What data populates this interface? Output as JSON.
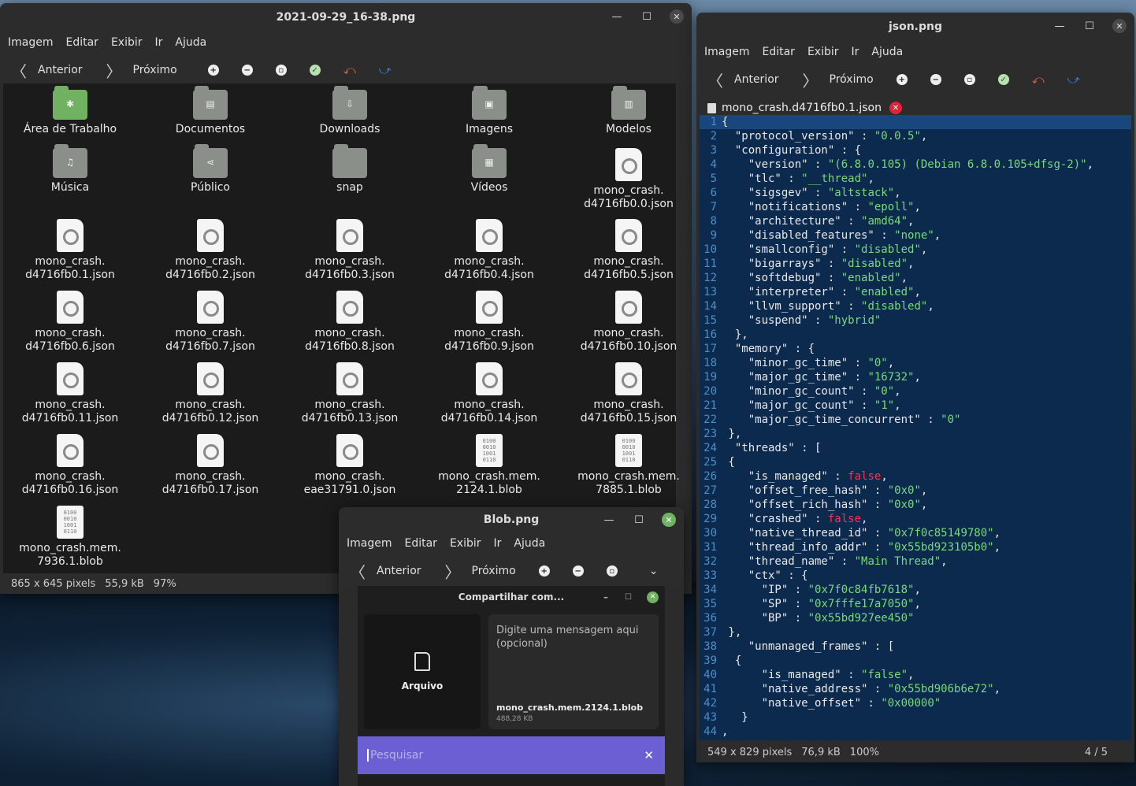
{
  "win1": {
    "title": "2021-09-29_16-38.png",
    "menu": [
      "Imagem",
      "Editar",
      "Exibir",
      "Ir",
      "Ajuda"
    ],
    "nav": {
      "prev": "Anterior",
      "next": "Próximo"
    },
    "items": [
      {
        "label1": "Área de Trabalho",
        "label2": "",
        "kind": "desktop"
      },
      {
        "label1": "Documentos",
        "label2": "",
        "kind": "folder"
      },
      {
        "label1": "Downloads",
        "label2": "",
        "kind": "folder"
      },
      {
        "label1": "Imagens",
        "label2": "",
        "kind": "folder"
      },
      {
        "label1": "Modelos",
        "label2": "",
        "kind": "folder"
      },
      {
        "label1": "Música",
        "label2": "",
        "kind": "folder"
      },
      {
        "label1": "Público",
        "label2": "",
        "kind": "folder"
      },
      {
        "label1": "snap",
        "label2": "",
        "kind": "folder"
      },
      {
        "label1": "Vídeos",
        "label2": "",
        "kind": "folder"
      },
      {
        "label1": "mono_crash.",
        "label2": "d4716fb0.0.json",
        "kind": "json"
      },
      {
        "label1": "mono_crash.",
        "label2": "d4716fb0.1.json",
        "kind": "json"
      },
      {
        "label1": "mono_crash.",
        "label2": "d4716fb0.2.json",
        "kind": "json"
      },
      {
        "label1": "mono_crash.",
        "label2": "d4716fb0.3.json",
        "kind": "json"
      },
      {
        "label1": "mono_crash.",
        "label2": "d4716fb0.4.json",
        "kind": "json"
      },
      {
        "label1": "mono_crash.",
        "label2": "d4716fb0.5.json",
        "kind": "json"
      },
      {
        "label1": "mono_crash.",
        "label2": "d4716fb0.6.json",
        "kind": "json"
      },
      {
        "label1": "mono_crash.",
        "label2": "d4716fb0.7.json",
        "kind": "json"
      },
      {
        "label1": "mono_crash.",
        "label2": "d4716fb0.8.json",
        "kind": "json"
      },
      {
        "label1": "mono_crash.",
        "label2": "d4716fb0.9.json",
        "kind": "json"
      },
      {
        "label1": "mono_crash.",
        "label2": "d4716fb0.10.json",
        "kind": "json"
      },
      {
        "label1": "mono_crash.",
        "label2": "d4716fb0.11.json",
        "kind": "json"
      },
      {
        "label1": "mono_crash.",
        "label2": "d4716fb0.12.json",
        "kind": "json"
      },
      {
        "label1": "mono_crash.",
        "label2": "d4716fb0.13.json",
        "kind": "json"
      },
      {
        "label1": "mono_crash.",
        "label2": "d4716fb0.14.json",
        "kind": "json"
      },
      {
        "label1": "mono_crash.",
        "label2": "d4716fb0.15.json",
        "kind": "json"
      },
      {
        "label1": "mono_crash.",
        "label2": "d4716fb0.16.json",
        "kind": "json"
      },
      {
        "label1": "mono_crash.",
        "label2": "d4716fb0.17.json",
        "kind": "json"
      },
      {
        "label1": "mono_crash.",
        "label2": "eae31791.0.json",
        "kind": "json"
      },
      {
        "label1": "mono_crash.mem.",
        "label2": "2124.1.blob",
        "kind": "blob"
      },
      {
        "label1": "mono_crash.mem.",
        "label2": "7885.1.blob",
        "kind": "blob"
      },
      {
        "label1": "mono_crash.mem.",
        "label2": "7936.1.blob",
        "kind": "blob"
      }
    ],
    "status": {
      "dims": "865 x 645 pixels",
      "size": "55,9 kB",
      "zoom": "97%"
    }
  },
  "win2": {
    "title": "json.png",
    "menu": [
      "Imagem",
      "Editar",
      "Exibir",
      "Ir",
      "Ajuda"
    ],
    "nav": {
      "prev": "Anterior",
      "next": "Próximo"
    },
    "tab": "mono_crash.d4716fb0.1.json",
    "lines": [
      [
        [
          "p",
          "{"
        ]
      ],
      [
        [
          "p",
          "  "
        ],
        [
          "k",
          "\"protocol_version\""
        ],
        [
          "p",
          " : "
        ],
        [
          "s",
          "\"0.0.5\""
        ],
        [
          "p",
          ","
        ]
      ],
      [
        [
          "p",
          "  "
        ],
        [
          "k",
          "\"configuration\""
        ],
        [
          "p",
          " : {"
        ]
      ],
      [
        [
          "p",
          "    "
        ],
        [
          "k",
          "\"version\""
        ],
        [
          "p",
          " : "
        ],
        [
          "s",
          "\"(6.8.0.105) (Debian 6.8.0.105+dfsg-2)\""
        ],
        [
          "p",
          ","
        ]
      ],
      [
        [
          "p",
          "    "
        ],
        [
          "k",
          "\"tlc\""
        ],
        [
          "p",
          " : "
        ],
        [
          "s",
          "\"__thread\""
        ],
        [
          "p",
          ","
        ]
      ],
      [
        [
          "p",
          "    "
        ],
        [
          "k",
          "\"sigsgev\""
        ],
        [
          "p",
          " : "
        ],
        [
          "s",
          "\"altstack\""
        ],
        [
          "p",
          ","
        ]
      ],
      [
        [
          "p",
          "    "
        ],
        [
          "k",
          "\"notifications\""
        ],
        [
          "p",
          " : "
        ],
        [
          "s",
          "\"epoll\""
        ],
        [
          "p",
          ","
        ]
      ],
      [
        [
          "p",
          "    "
        ],
        [
          "k",
          "\"architecture\""
        ],
        [
          "p",
          " : "
        ],
        [
          "s",
          "\"amd64\""
        ],
        [
          "p",
          ","
        ]
      ],
      [
        [
          "p",
          "    "
        ],
        [
          "k",
          "\"disabled_features\""
        ],
        [
          "p",
          " : "
        ],
        [
          "s",
          "\"none\""
        ],
        [
          "p",
          ","
        ]
      ],
      [
        [
          "p",
          "    "
        ],
        [
          "k",
          "\"smallconfig\""
        ],
        [
          "p",
          " : "
        ],
        [
          "s",
          "\"disabled\""
        ],
        [
          "p",
          ","
        ]
      ],
      [
        [
          "p",
          "    "
        ],
        [
          "k",
          "\"bigarrays\""
        ],
        [
          "p",
          " : "
        ],
        [
          "s",
          "\"disabled\""
        ],
        [
          "p",
          ","
        ]
      ],
      [
        [
          "p",
          "    "
        ],
        [
          "k",
          "\"softdebug\""
        ],
        [
          "p",
          " : "
        ],
        [
          "s",
          "\"enabled\""
        ],
        [
          "p",
          ","
        ]
      ],
      [
        [
          "p",
          "    "
        ],
        [
          "k",
          "\"interpreter\""
        ],
        [
          "p",
          " : "
        ],
        [
          "s",
          "\"enabled\""
        ],
        [
          "p",
          ","
        ]
      ],
      [
        [
          "p",
          "    "
        ],
        [
          "k",
          "\"llvm_support\""
        ],
        [
          "p",
          " : "
        ],
        [
          "s",
          "\"disabled\""
        ],
        [
          "p",
          ","
        ]
      ],
      [
        [
          "p",
          "    "
        ],
        [
          "k",
          "\"suspend\""
        ],
        [
          "p",
          " : "
        ],
        [
          "s",
          "\"hybrid\""
        ]
      ],
      [
        [
          "p",
          "  },"
        ]
      ],
      [
        [
          "p",
          "  "
        ],
        [
          "k",
          "\"memory\""
        ],
        [
          "p",
          " : {"
        ]
      ],
      [
        [
          "p",
          "    "
        ],
        [
          "k",
          "\"minor_gc_time\""
        ],
        [
          "p",
          " : "
        ],
        [
          "s",
          "\"0\""
        ],
        [
          "p",
          ","
        ]
      ],
      [
        [
          "p",
          "    "
        ],
        [
          "k",
          "\"major_gc_time\""
        ],
        [
          "p",
          " : "
        ],
        [
          "s",
          "\"16732\""
        ],
        [
          "p",
          ","
        ]
      ],
      [
        [
          "p",
          "    "
        ],
        [
          "k",
          "\"minor_gc_count\""
        ],
        [
          "p",
          " : "
        ],
        [
          "s",
          "\"0\""
        ],
        [
          "p",
          ","
        ]
      ],
      [
        [
          "p",
          "    "
        ],
        [
          "k",
          "\"major_gc_count\""
        ],
        [
          "p",
          " : "
        ],
        [
          "s",
          "\"1\""
        ],
        [
          "p",
          ","
        ]
      ],
      [
        [
          "p",
          "    "
        ],
        [
          "k",
          "\"major_gc_time_concurrent\""
        ],
        [
          "p",
          " : "
        ],
        [
          "s",
          "\"0\""
        ]
      ],
      [
        [
          "p",
          " },"
        ]
      ],
      [
        [
          "p",
          "  "
        ],
        [
          "k",
          "\"threads\""
        ],
        [
          "p",
          " : ["
        ]
      ],
      [
        [
          "p",
          " {"
        ]
      ],
      [
        [
          "p",
          "    "
        ],
        [
          "k",
          "\"is_managed\""
        ],
        [
          "p",
          " : "
        ],
        [
          "f",
          "false"
        ],
        [
          "p",
          ","
        ]
      ],
      [
        [
          "p",
          "    "
        ],
        [
          "k",
          "\"offset_free_hash\""
        ],
        [
          "p",
          " : "
        ],
        [
          "s",
          "\"0x0\""
        ],
        [
          "p",
          ","
        ]
      ],
      [
        [
          "p",
          "    "
        ],
        [
          "k",
          "\"offset_rich_hash\""
        ],
        [
          "p",
          " : "
        ],
        [
          "s",
          "\"0x0\""
        ],
        [
          "p",
          ","
        ]
      ],
      [
        [
          "p",
          "    "
        ],
        [
          "k",
          "\"crashed\""
        ],
        [
          "p",
          " : "
        ],
        [
          "f",
          "false"
        ],
        [
          "p",
          ","
        ]
      ],
      [
        [
          "p",
          "    "
        ],
        [
          "k",
          "\"native_thread_id\""
        ],
        [
          "p",
          " : "
        ],
        [
          "s",
          "\"0x7f0c85149780\""
        ],
        [
          "p",
          ","
        ]
      ],
      [
        [
          "p",
          "    "
        ],
        [
          "k",
          "\"thread_info_addr\""
        ],
        [
          "p",
          " : "
        ],
        [
          "s",
          "\"0x55bd923105b0\""
        ],
        [
          "p",
          ","
        ]
      ],
      [
        [
          "p",
          "    "
        ],
        [
          "k",
          "\"thread_name\""
        ],
        [
          "p",
          " : "
        ],
        [
          "s",
          "\"Main Thread\""
        ],
        [
          "p",
          ","
        ]
      ],
      [
        [
          "p",
          "    "
        ],
        [
          "k",
          "\"ctx\""
        ],
        [
          "p",
          " : {"
        ]
      ],
      [
        [
          "p",
          "      "
        ],
        [
          "k",
          "\"IP\""
        ],
        [
          "p",
          " : "
        ],
        [
          "s",
          "\"0x7f0c84fb7618\""
        ],
        [
          "p",
          ","
        ]
      ],
      [
        [
          "p",
          "      "
        ],
        [
          "k",
          "\"SP\""
        ],
        [
          "p",
          " : "
        ],
        [
          "s",
          "\"0x7fffe17a7050\""
        ],
        [
          "p",
          ","
        ]
      ],
      [
        [
          "p",
          "      "
        ],
        [
          "k",
          "\"BP\""
        ],
        [
          "p",
          " : "
        ],
        [
          "s",
          "\"0x55bd927ee450\""
        ]
      ],
      [
        [
          "p",
          " },"
        ]
      ],
      [
        [
          "p",
          "    "
        ],
        [
          "k",
          "\"unmanaged_frames\""
        ],
        [
          "p",
          " : ["
        ]
      ],
      [
        [
          "p",
          "  {"
        ]
      ],
      [
        [
          "p",
          "      "
        ],
        [
          "k",
          "\"is_managed\""
        ],
        [
          "p",
          " : "
        ],
        [
          "s",
          "\"false\""
        ],
        [
          "p",
          ","
        ]
      ],
      [
        [
          "p",
          "      "
        ],
        [
          "k",
          "\"native_address\""
        ],
        [
          "p",
          " : "
        ],
        [
          "s",
          "\"0x55bd906b6e72\""
        ],
        [
          "p",
          ","
        ]
      ],
      [
        [
          "p",
          "      "
        ],
        [
          "k",
          "\"native_offset\""
        ],
        [
          "p",
          " : "
        ],
        [
          "s",
          "\"0x00000\""
        ]
      ],
      [
        [
          "p",
          "   }"
        ]
      ],
      [
        [
          "p",
          ","
        ]
      ]
    ],
    "status": {
      "dims": "549 x 829 pixels",
      "size": "76,9 kB",
      "zoom": "100%",
      "page": "4 / 5"
    }
  },
  "win3": {
    "title": "Blob.png",
    "menu": [
      "Imagem",
      "Editar",
      "Exibir",
      "Ir",
      "Ajuda"
    ],
    "nav": {
      "prev": "Anterior",
      "next": "Próximo"
    },
    "dialog": {
      "title": "Compartilhar com...",
      "file_btn": "Arquivo",
      "message_placeholder": "Digite uma mensagem aqui (opcional)",
      "filename": "mono_crash.mem.2124.1.blob",
      "filesize": "488,28 KB",
      "search_placeholder": "Pesquisar"
    }
  },
  "colors": {
    "accent_green": "#71b162",
    "code_bg": "#0b2a4e",
    "string": "#7ad97a",
    "boolean": "#ff3050",
    "search_bar": "#6b5fd3"
  }
}
